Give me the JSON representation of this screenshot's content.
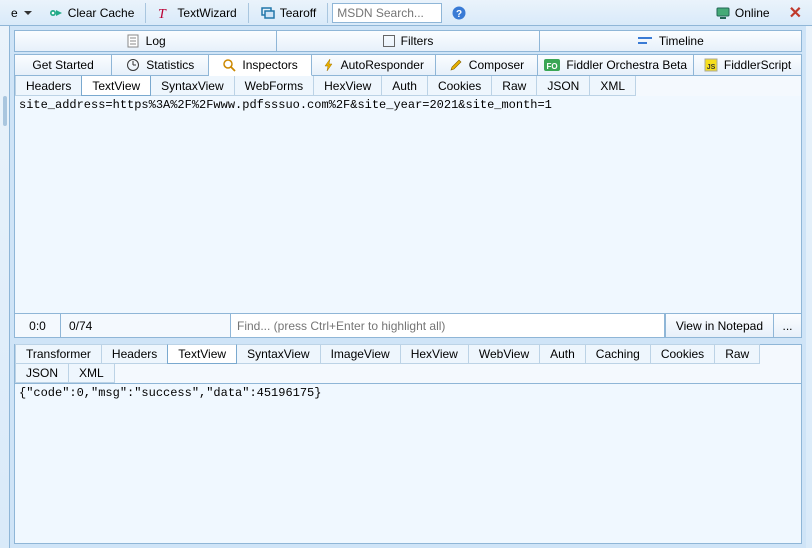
{
  "toolbar": {
    "clear_cache": "Clear Cache",
    "text_wizard": "TextWizard",
    "tearoff": "Tearoff",
    "search_placeholder": "MSDN Search...",
    "online": "Online"
  },
  "top_tabs": {
    "log": "Log",
    "filters": "Filters",
    "timeline": "Timeline"
  },
  "mid_tabs": {
    "get_started": "Get Started",
    "statistics": "Statistics",
    "inspectors": "Inspectors",
    "autoresponder": "AutoResponder",
    "composer": "Composer",
    "orchestra": "Fiddler Orchestra Beta",
    "fiddlerscript": "FiddlerScript"
  },
  "req_tabs": {
    "headers": "Headers",
    "textview": "TextView",
    "syntaxview": "SyntaxView",
    "webforms": "WebForms",
    "hexview": "HexView",
    "auth": "Auth",
    "cookies": "Cookies",
    "raw": "Raw",
    "json": "JSON",
    "xml": "XML"
  },
  "request_body": "site_address=https%3A%2F%2Fwww.pdfsssuo.com%2F&site_year=2021&site_month=1",
  "findbar": {
    "pos": "0:0",
    "range": "0/74",
    "placeholder": "Find... (press Ctrl+Enter to highlight all)",
    "view_btn": "View in Notepad",
    "more": "..."
  },
  "resp_tabs": {
    "transformer": "Transformer",
    "headers": "Headers",
    "textview": "TextView",
    "syntaxview": "SyntaxView",
    "imageview": "ImageView",
    "hexview": "HexView",
    "webview": "WebView",
    "auth": "Auth",
    "caching": "Caching",
    "cookies": "Cookies",
    "raw": "Raw",
    "json": "JSON",
    "xml": "XML"
  },
  "response_body": "{\"code\":0,\"msg\":\"success\",\"data\":45196175}"
}
